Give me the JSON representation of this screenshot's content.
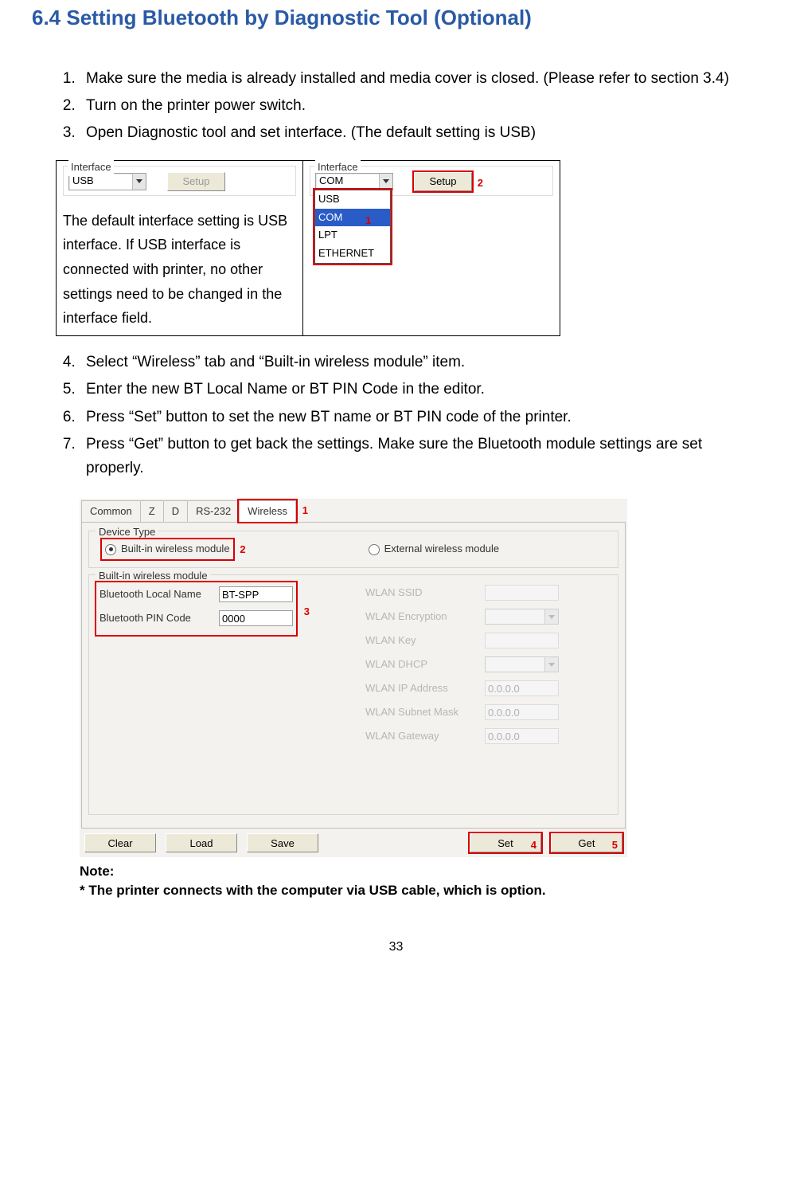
{
  "heading": "6.4   Setting Bluetooth by Diagnostic Tool (Optional)",
  "steps": {
    "s1": "Make sure the media is already installed and media cover is closed. (Please refer to section 3.4)",
    "s2": "Turn on the printer power switch.",
    "s3": "Open Diagnostic tool and set interface. (The default setting is USB)",
    "s4": "Select “Wireless” tab and “Built-in wireless module” item.",
    "s5": "Enter the new BT Local Name or BT PIN Code in the editor.",
    "s6": "Press “Set” button to set the new BT name or BT PIN code of the printer.",
    "s7": "Press “Get” button to get back the settings. Make sure the Bluetooth module settings are set properly."
  },
  "fig1": {
    "left": {
      "legend": "Interface",
      "combo_value": "USB",
      "setup_btn": "Setup",
      "note": "The default interface setting is USB interface. If USB interface is connected with printer, no other settings need to be changed in the interface field."
    },
    "right": {
      "legend": "Interface",
      "combo_value": "COM",
      "setup_btn": "Setup",
      "options": [
        "USB",
        "COM",
        "LPT",
        "ETHERNET"
      ],
      "callout1": "1",
      "callout2": "2"
    }
  },
  "fig2": {
    "tabs": [
      "Common",
      "Z",
      "D",
      "RS-232",
      "Wireless"
    ],
    "device_type_title": "Device Type",
    "radio1": "Built-in wireless module",
    "radio2": "External wireless module",
    "group_title": "Built-in wireless module",
    "bt_name_label": "Bluetooth Local Name",
    "bt_name_value": "BT-SPP",
    "bt_pin_label": "Bluetooth PIN Code",
    "bt_pin_value": "0000",
    "wlan_ssid": "WLAN SSID",
    "wlan_encryption": "WLAN Encryption",
    "wlan_key": "WLAN Key",
    "wlan_dhcp": "WLAN DHCP",
    "wlan_ip": "WLAN IP Address",
    "wlan_subnet": "WLAN Subnet Mask",
    "wlan_gateway": "WLAN Gateway",
    "ip_placeholder": "0.0.0.0",
    "btn_clear": "Clear",
    "btn_load": "Load",
    "btn_save": "Save",
    "btn_set": "Set",
    "btn_get": "Get",
    "c1": "1",
    "c2": "2",
    "c3": "3",
    "c4": "4",
    "c5": "5"
  },
  "note_title": "Note:",
  "note_body": "* The printer connects with the computer via USB cable, which is option.",
  "page_number": "33"
}
